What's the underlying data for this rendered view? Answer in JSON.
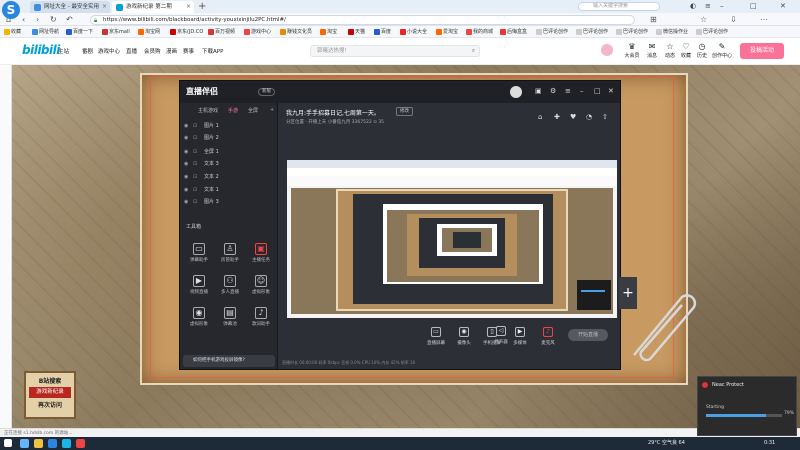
{
  "browser": {
    "tabs": [
      {
        "label": "网址大全 - 最安全实用",
        "close": "×"
      },
      {
        "label": "游戏新纪录 第二期",
        "close": "×"
      }
    ],
    "new_tab": "+",
    "tab_search_placeholder": "输入关键字搜索",
    "url": "https://www.bilibili.com/blackboard/activity-youxixinjilu2PC.html#/",
    "bookmarks": [
      "收藏",
      "网址导航",
      "百度一下",
      "京东mall",
      "淘宝网",
      "京东(JD.CO",
      "百万视频",
      "游戏中心",
      "赚钱文化员",
      "淘宝",
      "天猫",
      "百度",
      "小说大全",
      "爱淘宝",
      "我的商城",
      "后悔盒盒",
      "巴评论创作",
      "巴评论创作",
      "巴评论创作",
      "微信操作业",
      "巴评论创作"
    ],
    "status_text": "正在连接 s1.hdslb.com 的源站..."
  },
  "bili": {
    "logo": "bilibili",
    "nav": [
      "主站",
      "番剧",
      "游戏中心",
      "直播",
      "会员购",
      "漫画",
      "赛事",
      "下载APP"
    ],
    "search_placeholder": "郭曦达热搜!",
    "user_icons": [
      {
        "label": "大会员",
        "glyph": "♛"
      },
      {
        "label": "消息",
        "glyph": "✉"
      },
      {
        "label": "动态",
        "glyph": "☆"
      },
      {
        "label": "收藏",
        "glyph": "♡"
      },
      {
        "label": "历史",
        "glyph": "◷"
      },
      {
        "label": "创作中心",
        "glyph": "✎"
      }
    ],
    "upload_label": "投稿活动"
  },
  "app": {
    "logo": "直播伴侣",
    "version": "新版",
    "left_tabs": [
      "主机游戏",
      "手游",
      "全屏"
    ],
    "scenes": [
      "图片 1",
      "图片 2",
      "全屏 1",
      "文本 3",
      "文本 2",
      "文本 1",
      "图片 3"
    ],
    "tools_label": "工具箱",
    "tools": [
      {
        "label": "弹幕助手",
        "glyph": "▭"
      },
      {
        "label": "房管助手",
        "glyph": "♙"
      },
      {
        "label": "主播任务",
        "glyph": "▣"
      },
      {
        "label": "视频直播",
        "glyph": "▶"
      },
      {
        "label": "多人直播",
        "glyph": "⚇"
      },
      {
        "label": "虚拟形象",
        "glyph": "☺"
      },
      {
        "label": "虚拟形象",
        "glyph": "◉"
      },
      {
        "label": "弹幕池",
        "glyph": "▤"
      },
      {
        "label": "歌词助手",
        "glyph": "♪"
      }
    ],
    "mirror_text": "如何把手机游戏投屏镜像?",
    "room_title": "我九月:手手招募日记,七周第一天。",
    "room_edit": "修改",
    "room_sub": "分区位置 · 开播上天    小番茄九月    3367522    ⊙ 35",
    "bottom_controls": [
      {
        "label": "直播屏幕",
        "glyph": "▭"
      },
      {
        "label": "摄像头",
        "glyph": "◉"
      },
      {
        "label": "手机投屏",
        "glyph": "▯"
      },
      {
        "label": "多媒体",
        "glyph": "▶"
      },
      {
        "label": "麦克风",
        "glyph": "♪"
      },
      {
        "label": "扬声器",
        "glyph": "◁"
      }
    ],
    "start_live": "开始直播",
    "statusbar": "直播时长 00:00:00    码率 0kbps    丢帧 0.0%    CPU 10%    内存 42%    帧率 30"
  },
  "promo": {
    "line1": "B站搜索",
    "line2": "游戏新纪录",
    "line3": "再次访问"
  },
  "neac": {
    "title": "Neac Protect",
    "status": "Starting",
    "percent": "79%",
    "progress": 0.79
  },
  "taskbar": {
    "weather": "29°C 空气良 64",
    "time": "0:31"
  }
}
